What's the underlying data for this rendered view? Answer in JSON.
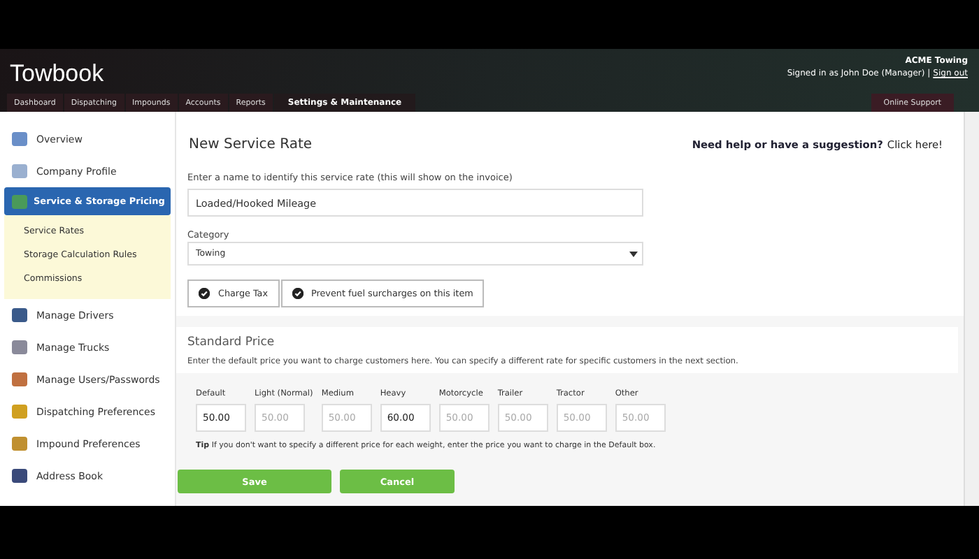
{
  "header": {
    "app_title": "Towbook",
    "company": "ACME Towing",
    "signed_in_text": "Signed in as John Doe (Manager) |",
    "sign_out": "Sign out",
    "tabs": [
      {
        "label": "Dashboard",
        "selected": false
      },
      {
        "label": "Dispatching",
        "selected": false
      },
      {
        "label": "Impounds",
        "selected": false
      },
      {
        "label": "Accounts",
        "selected": false
      },
      {
        "label": "Reports",
        "selected": false
      },
      {
        "label": "Settings & Maintenance",
        "selected": true
      }
    ],
    "support_tab": "Online Support"
  },
  "sidebar": {
    "items": [
      {
        "label": "Overview",
        "selected": false
      },
      {
        "label": "Company Profile",
        "selected": false
      },
      {
        "label": "Service & Storage Pricing",
        "selected": true,
        "children": [
          {
            "label": "Service Rates"
          },
          {
            "label": "Storage Calculation Rules"
          },
          {
            "label": "Commissions"
          }
        ]
      },
      {
        "label": "Manage Drivers",
        "selected": false
      },
      {
        "label": "Manage Trucks",
        "selected": false
      },
      {
        "label": "Manage Users/Passwords",
        "selected": false
      },
      {
        "label": "Dispatching Preferences",
        "selected": false
      },
      {
        "label": "Impound Preferences",
        "selected": false
      },
      {
        "label": "Address Book",
        "selected": false
      }
    ]
  },
  "main": {
    "title": "New Service Rate",
    "help_text": "Need help or have a suggestion?",
    "help_link": "Click here!",
    "name_label": "Enter a name to identify this service rate (this will show on the invoice)",
    "name_value": "Loaded/Hooked Mileage",
    "category_label": "Category",
    "category_value": "Towing",
    "options": [
      {
        "label": "Charge Tax",
        "checked": true
      },
      {
        "label": "Prevent fuel surcharges on this item",
        "checked": true
      }
    ],
    "price_title": "Standard Price",
    "price_desc": "Enter the default price you want to charge customers here. You can specify a different rate for specific customers in the next section.",
    "prices": [
      {
        "label": "Default",
        "value": "50.00"
      },
      {
        "label": "Light (Normal)",
        "placeholder": "50.00"
      },
      {
        "label": "Medium",
        "placeholder": "50.00"
      },
      {
        "label": "Heavy",
        "value": "60.00"
      },
      {
        "label": "Motorcycle",
        "placeholder": "50.00"
      },
      {
        "label": "Trailer",
        "placeholder": "50.00"
      },
      {
        "label": "Tractor",
        "placeholder": "50.00"
      },
      {
        "label": "Other",
        "placeholder": "50.00"
      }
    ],
    "tip": "**Tip** If you don't want to specify a different price for each weight, enter the price you want to charge in the Default box.",
    "buttons": [
      "Save",
      "Cancel"
    ]
  }
}
